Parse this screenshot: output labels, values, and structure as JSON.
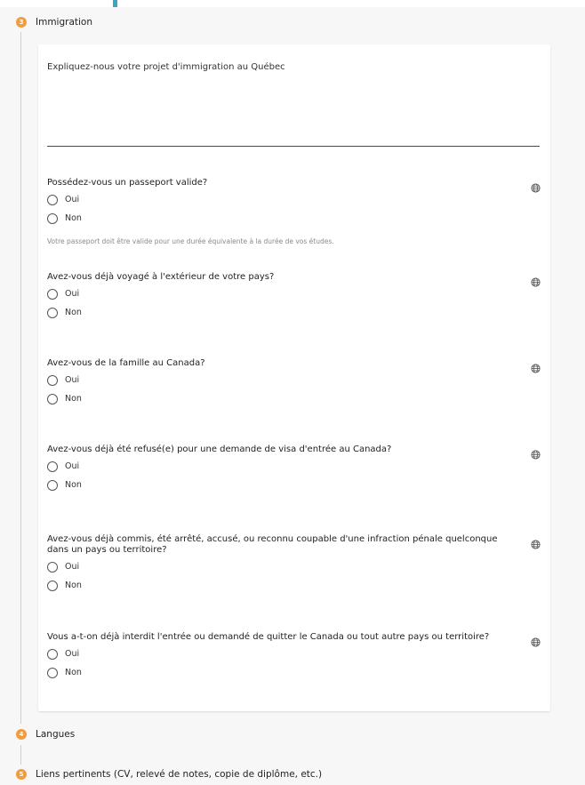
{
  "steps": [
    {
      "number": "3",
      "label": "Immigration"
    },
    {
      "number": "4",
      "label": "Langues"
    },
    {
      "number": "5",
      "label": "Liens pertinents (CV, relevé de notes, copie de diplôme, etc.)"
    }
  ],
  "project": {
    "placeholder": "Expliquez-nous votre projet d'immigration au Québec"
  },
  "options": {
    "yes": "Oui",
    "no": "Non"
  },
  "questions": [
    {
      "text": "Possédez-vous un passeport valide?",
      "helper": "Votre passeport doit être valide pour une durée équivalente à la durée de vos études."
    },
    {
      "text": "Avez-vous déjà voyagé à l'extérieur de votre pays?"
    },
    {
      "text": "Avez-vous de la famille au Canada?"
    },
    {
      "text": "Avez-vous déjà été refusé(e) pour une demande de visa d'entrée au Canada?"
    },
    {
      "text": "Avez-vous déjà commis, été arrêté, accusé, ou reconnu coupable d'une infraction pénale quelconque dans un pays ou territoire?"
    },
    {
      "text": "Vous a-t-on déjà interdit l'entrée ou demandé de quitter le Canada ou tout autre pays ou territoire?"
    }
  ],
  "icons": {
    "translate": "globe-icon"
  },
  "colors": {
    "step_badge": "#f39c3c",
    "accent": "#3aa6c1"
  }
}
